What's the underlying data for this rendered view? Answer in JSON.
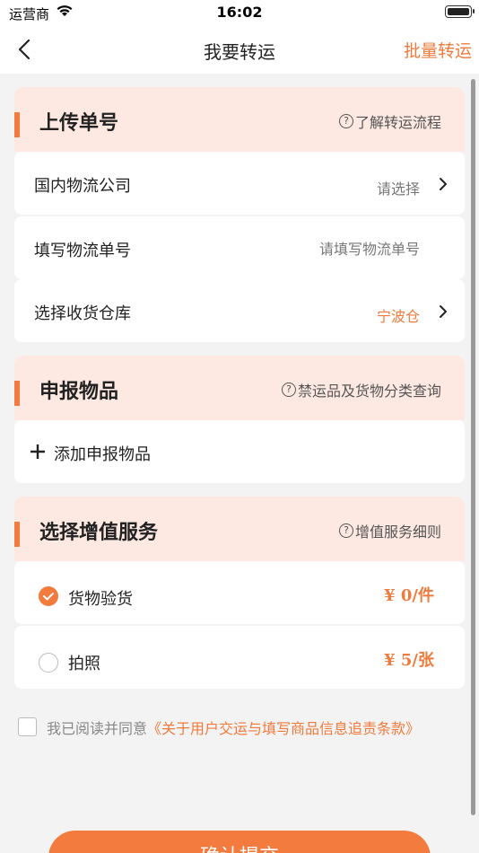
{
  "status_bar": {
    "carrier": "运营商",
    "time": "16:02"
  },
  "nav": {
    "title": "我要转运",
    "batch_label": "批量转运"
  },
  "upload_section": {
    "title": "上传单号",
    "help": "了解转运流程",
    "rows": {
      "company_label": "国内物流公司",
      "company_value": "请选择",
      "tracking_label": "填写物流单号",
      "tracking_placeholder": "请填写物流单号",
      "warehouse_label": "选择收货仓库",
      "warehouse_value": "宁波仓"
    }
  },
  "declare_section": {
    "title": "申报物品",
    "help": "禁运品及货物分类查询",
    "add_label": "添加申报物品"
  },
  "service_section": {
    "title": "选择增值服务",
    "help": "增值服务细则",
    "services": [
      {
        "label": "货物验货",
        "price": "¥ 0/件",
        "checked": true
      },
      {
        "label": "拍照",
        "price": "¥ 5/张",
        "checked": false
      }
    ]
  },
  "agreement": {
    "prefix": "我已阅读并同意",
    "link": "《关于用户交运与填写商品信息追责条款》"
  },
  "submit_label": "确认提交",
  "colors": {
    "accent": "#f47b3e",
    "section_bg": "#fde9e2",
    "page_bg": "#f3f3f3"
  }
}
